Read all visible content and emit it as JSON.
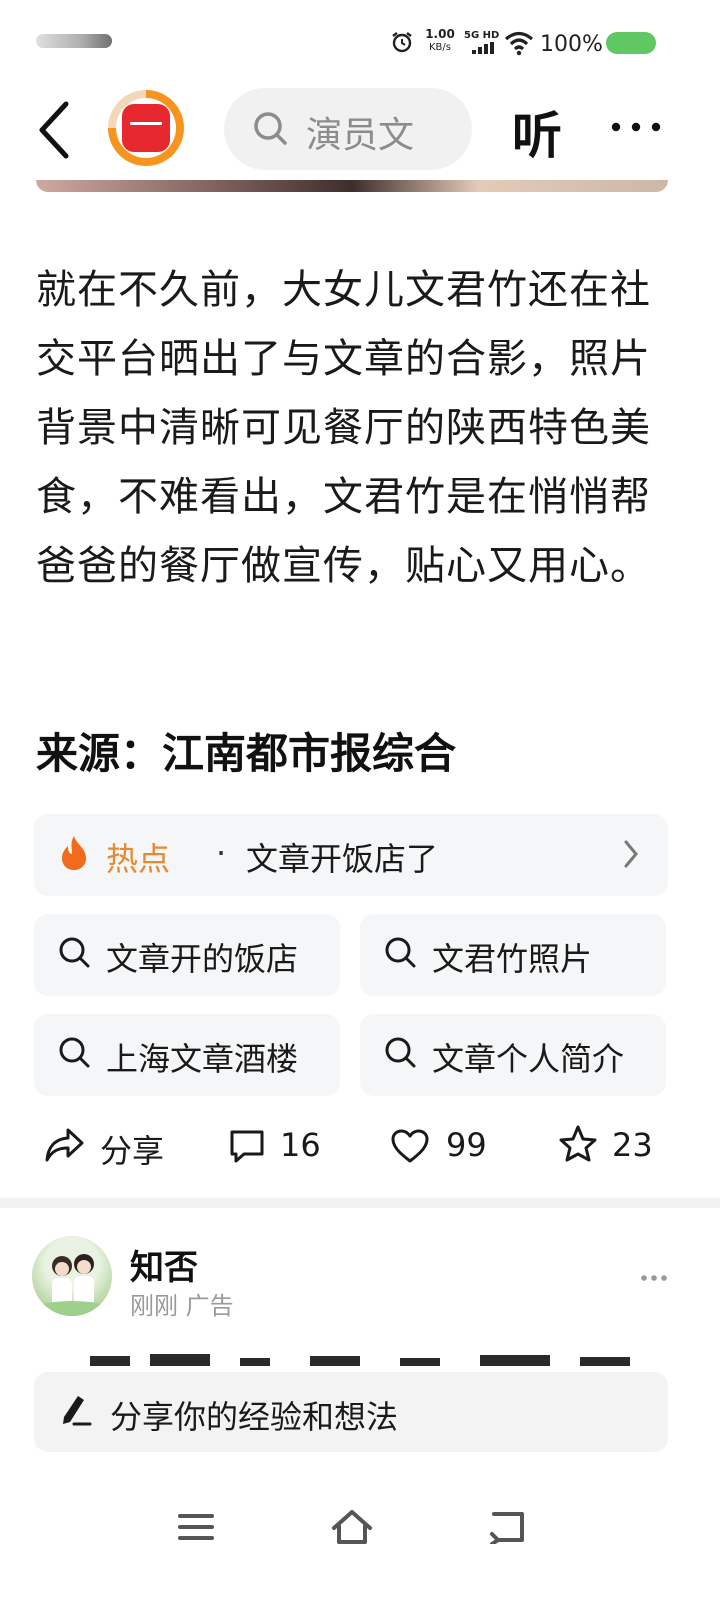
{
  "status_bar": {
    "net_speed_value": "1.00",
    "net_speed_unit": "KB/s",
    "network_type": "5G HD",
    "battery_percent": "100%"
  },
  "top_nav": {
    "search_placeholder": "演员文",
    "listen_label": "听"
  },
  "article": {
    "paragraph": "就在不久前，大女儿文君竹还在社交平台晒出了与文章的合影，照片背景中清晰可见餐厅的陕西特色美食，不难看出，文君竹是在悄悄帮爸爸的餐厅做宣传，贴心又用心。",
    "source": "来源：江南都市报综合"
  },
  "hot_topic": {
    "label": "热点",
    "separator": "·",
    "title": "文章开饭店了"
  },
  "related_searches": [
    {
      "label": "文章开的饭店"
    },
    {
      "label": "文君竹照片"
    },
    {
      "label": "上海文章酒楼"
    },
    {
      "label": "文章个人简介"
    }
  ],
  "actions": {
    "share_label": "分享",
    "comment_count": "16",
    "like_count": "99",
    "favorite_count": "23"
  },
  "ad_post": {
    "author": "知否",
    "time": "刚刚",
    "tag": "广告"
  },
  "comment_input": {
    "placeholder": "分享你的经验和想法"
  },
  "colors": {
    "accent_orange": "#e8892f",
    "battery_green": "#5fc862",
    "logo_red": "#e8282f"
  }
}
